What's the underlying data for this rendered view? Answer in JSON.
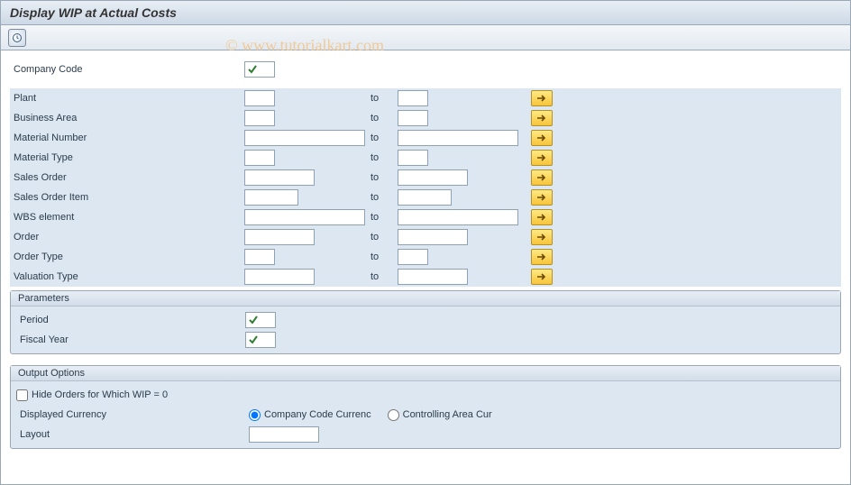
{
  "title": "Display WIP at Actual Costs",
  "watermark": "© www.tutorialkart.com",
  "labels": {
    "company_code": "Company Code",
    "plant": "Plant",
    "business_area": "Business Area",
    "material_number": "Material Number",
    "material_type": "Material Type",
    "sales_order": "Sales Order",
    "sales_order_item": "Sales Order Item",
    "wbs_element": "WBS element",
    "order": "Order",
    "order_type": "Order Type",
    "valuation_type": "Valuation Type",
    "to": "to",
    "parameters": "Parameters",
    "period": "Period",
    "fiscal_year": "Fiscal Year",
    "output_options": "Output Options",
    "hide_zero": "Hide Orders for Which WIP = 0",
    "displayed_currency": "Displayed Currency",
    "radio_cc": "Company Code Currenc",
    "radio_ca": "Controlling Area Cur",
    "layout": "Layout"
  },
  "values": {
    "company_code": "",
    "plant_from": "",
    "plant_to": "",
    "business_area_from": "",
    "business_area_to": "",
    "material_number_from": "",
    "material_number_to": "",
    "material_type_from": "",
    "material_type_to": "",
    "sales_order_from": "",
    "sales_order_to": "",
    "sales_order_item_from": "",
    "sales_order_item_to": "",
    "wbs_element_from": "",
    "wbs_element_to": "",
    "order_from": "",
    "order_to": "",
    "order_type_from": "",
    "order_type_to": "",
    "valuation_type_from": "",
    "valuation_type_to": "",
    "period": "",
    "fiscal_year": "",
    "hide_zero_checked": false,
    "currency_selected": "cc",
    "layout": ""
  }
}
